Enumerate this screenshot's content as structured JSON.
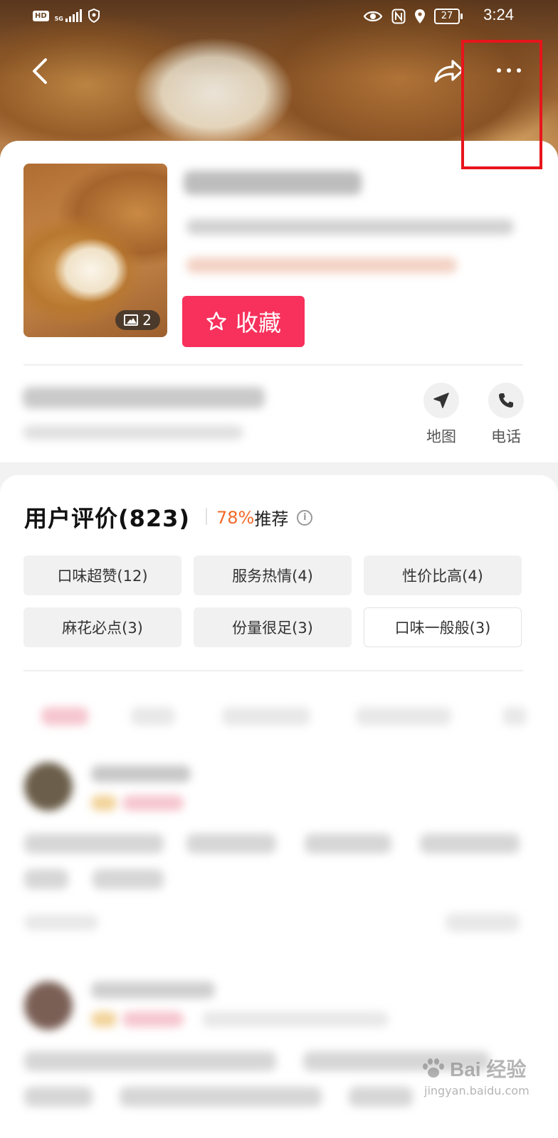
{
  "status_bar": {
    "left_badge": "HD",
    "network": "5G",
    "battery": "27",
    "time": "3:24"
  },
  "shop": {
    "photo_count": "2",
    "favorite_label": "收藏",
    "actions": [
      {
        "label": "地图",
        "icon": "navigation-arrow-icon"
      },
      {
        "label": "电话",
        "icon": "phone-icon"
      }
    ]
  },
  "reviews": {
    "title": "用户评价(823)",
    "recommend_pct": "78%",
    "recommend_label": "推荐",
    "tags": [
      {
        "label": "口味超赞(12)",
        "outlined": false
      },
      {
        "label": "服务热情(4)",
        "outlined": false
      },
      {
        "label": "性价比高(4)",
        "outlined": false
      },
      {
        "label": "麻花必点(3)",
        "outlined": false
      },
      {
        "label": "份量很足(3)",
        "outlined": false
      },
      {
        "label": "口味一般般(3)",
        "outlined": true
      }
    ]
  },
  "watermark": {
    "brand": "Bai 经验",
    "url": "jingyan.baidu.com"
  },
  "colors": {
    "accent": "#f7315c",
    "percent": "#f26a2a",
    "highlight_box": "#e8141b"
  }
}
